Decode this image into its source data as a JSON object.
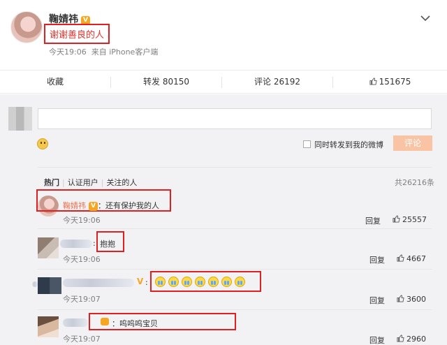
{
  "post": {
    "author": "鞠婧祎",
    "verified_badge": "V",
    "text": "谢谢善良的人",
    "time": "今天19:06",
    "source": "来自 iPhone客户端"
  },
  "actions": {
    "favorite": "收藏",
    "repost": "转发 80150",
    "comment": "评论 26192",
    "like": "151675"
  },
  "composer": {
    "placeholder": "",
    "also_repost": "同时转发到我的微博",
    "submit": "评论"
  },
  "tabs": [
    "热门",
    "认证用户",
    "关注的人"
  ],
  "total": "共26216条",
  "comments": [
    {
      "name": "鞠婧祎",
      "badge": "V",
      "text": "：还有保护我的人",
      "time": "今天19:06",
      "reply": "回复",
      "likes": "25557"
    },
    {
      "name": "",
      "text": "抱抱",
      "time": "今天19:06",
      "reply": "回复",
      "likes": "4667"
    },
    {
      "name": "",
      "badge": "V",
      "text": "",
      "time": "今天19:07",
      "reply": "回复",
      "likes": "3600",
      "emoji_count": 7
    },
    {
      "name": "",
      "text": "：呜呜呜宝贝",
      "time": "今天19:07",
      "reply": "回复",
      "likes": "2960"
    }
  ],
  "colors": {
    "highlight": "#e02020",
    "link": "#eb7350",
    "submit": "#f9c4a4",
    "badge": "#f5a623"
  }
}
